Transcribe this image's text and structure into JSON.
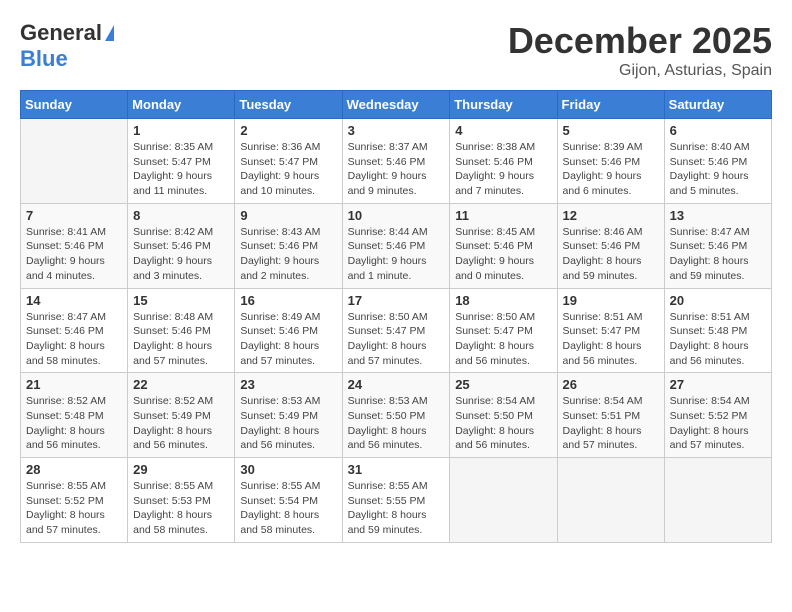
{
  "header": {
    "logo_general": "General",
    "logo_blue": "Blue",
    "month": "December 2025",
    "location": "Gijon, Asturias, Spain"
  },
  "days_of_week": [
    "Sunday",
    "Monday",
    "Tuesday",
    "Wednesday",
    "Thursday",
    "Friday",
    "Saturday"
  ],
  "weeks": [
    [
      {
        "day": "",
        "info": ""
      },
      {
        "day": "1",
        "info": "Sunrise: 8:35 AM\nSunset: 5:47 PM\nDaylight: 9 hours\nand 11 minutes."
      },
      {
        "day": "2",
        "info": "Sunrise: 8:36 AM\nSunset: 5:47 PM\nDaylight: 9 hours\nand 10 minutes."
      },
      {
        "day": "3",
        "info": "Sunrise: 8:37 AM\nSunset: 5:46 PM\nDaylight: 9 hours\nand 9 minutes."
      },
      {
        "day": "4",
        "info": "Sunrise: 8:38 AM\nSunset: 5:46 PM\nDaylight: 9 hours\nand 7 minutes."
      },
      {
        "day": "5",
        "info": "Sunrise: 8:39 AM\nSunset: 5:46 PM\nDaylight: 9 hours\nand 6 minutes."
      },
      {
        "day": "6",
        "info": "Sunrise: 8:40 AM\nSunset: 5:46 PM\nDaylight: 9 hours\nand 5 minutes."
      }
    ],
    [
      {
        "day": "7",
        "info": "Sunrise: 8:41 AM\nSunset: 5:46 PM\nDaylight: 9 hours\nand 4 minutes."
      },
      {
        "day": "8",
        "info": "Sunrise: 8:42 AM\nSunset: 5:46 PM\nDaylight: 9 hours\nand 3 minutes."
      },
      {
        "day": "9",
        "info": "Sunrise: 8:43 AM\nSunset: 5:46 PM\nDaylight: 9 hours\nand 2 minutes."
      },
      {
        "day": "10",
        "info": "Sunrise: 8:44 AM\nSunset: 5:46 PM\nDaylight: 9 hours\nand 1 minute."
      },
      {
        "day": "11",
        "info": "Sunrise: 8:45 AM\nSunset: 5:46 PM\nDaylight: 9 hours\nand 0 minutes."
      },
      {
        "day": "12",
        "info": "Sunrise: 8:46 AM\nSunset: 5:46 PM\nDaylight: 8 hours\nand 59 minutes."
      },
      {
        "day": "13",
        "info": "Sunrise: 8:47 AM\nSunset: 5:46 PM\nDaylight: 8 hours\nand 59 minutes."
      }
    ],
    [
      {
        "day": "14",
        "info": "Sunrise: 8:47 AM\nSunset: 5:46 PM\nDaylight: 8 hours\nand 58 minutes."
      },
      {
        "day": "15",
        "info": "Sunrise: 8:48 AM\nSunset: 5:46 PM\nDaylight: 8 hours\nand 57 minutes."
      },
      {
        "day": "16",
        "info": "Sunrise: 8:49 AM\nSunset: 5:46 PM\nDaylight: 8 hours\nand 57 minutes."
      },
      {
        "day": "17",
        "info": "Sunrise: 8:50 AM\nSunset: 5:47 PM\nDaylight: 8 hours\nand 57 minutes."
      },
      {
        "day": "18",
        "info": "Sunrise: 8:50 AM\nSunset: 5:47 PM\nDaylight: 8 hours\nand 56 minutes."
      },
      {
        "day": "19",
        "info": "Sunrise: 8:51 AM\nSunset: 5:47 PM\nDaylight: 8 hours\nand 56 minutes."
      },
      {
        "day": "20",
        "info": "Sunrise: 8:51 AM\nSunset: 5:48 PM\nDaylight: 8 hours\nand 56 minutes."
      }
    ],
    [
      {
        "day": "21",
        "info": "Sunrise: 8:52 AM\nSunset: 5:48 PM\nDaylight: 8 hours\nand 56 minutes."
      },
      {
        "day": "22",
        "info": "Sunrise: 8:52 AM\nSunset: 5:49 PM\nDaylight: 8 hours\nand 56 minutes."
      },
      {
        "day": "23",
        "info": "Sunrise: 8:53 AM\nSunset: 5:49 PM\nDaylight: 8 hours\nand 56 minutes."
      },
      {
        "day": "24",
        "info": "Sunrise: 8:53 AM\nSunset: 5:50 PM\nDaylight: 8 hours\nand 56 minutes."
      },
      {
        "day": "25",
        "info": "Sunrise: 8:54 AM\nSunset: 5:50 PM\nDaylight: 8 hours\nand 56 minutes."
      },
      {
        "day": "26",
        "info": "Sunrise: 8:54 AM\nSunset: 5:51 PM\nDaylight: 8 hours\nand 57 minutes."
      },
      {
        "day": "27",
        "info": "Sunrise: 8:54 AM\nSunset: 5:52 PM\nDaylight: 8 hours\nand 57 minutes."
      }
    ],
    [
      {
        "day": "28",
        "info": "Sunrise: 8:55 AM\nSunset: 5:52 PM\nDaylight: 8 hours\nand 57 minutes."
      },
      {
        "day": "29",
        "info": "Sunrise: 8:55 AM\nSunset: 5:53 PM\nDaylight: 8 hours\nand 58 minutes."
      },
      {
        "day": "30",
        "info": "Sunrise: 8:55 AM\nSunset: 5:54 PM\nDaylight: 8 hours\nand 58 minutes."
      },
      {
        "day": "31",
        "info": "Sunrise: 8:55 AM\nSunset: 5:55 PM\nDaylight: 8 hours\nand 59 minutes."
      },
      {
        "day": "",
        "info": ""
      },
      {
        "day": "",
        "info": ""
      },
      {
        "day": "",
        "info": ""
      }
    ]
  ]
}
